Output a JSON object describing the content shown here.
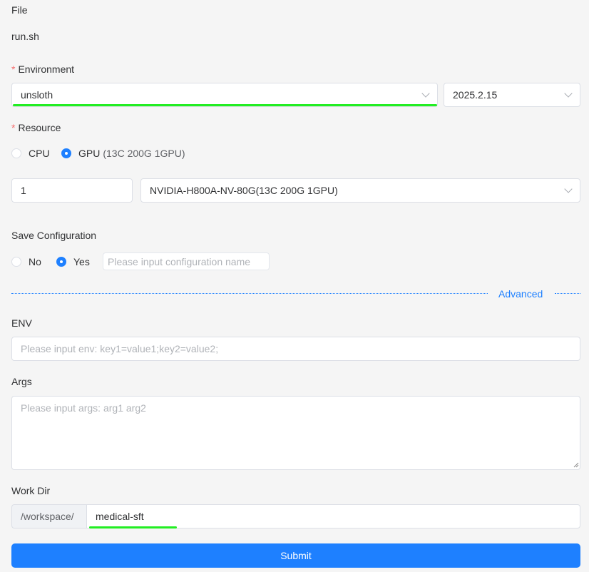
{
  "file": {
    "label": "File",
    "value": "run.sh"
  },
  "environment": {
    "required_mark": "*",
    "label": "Environment",
    "image_value": "unsloth",
    "version_value": "2025.2.15"
  },
  "resource": {
    "required_mark": "*",
    "label": "Resource",
    "options": [
      {
        "label": "CPU",
        "detail": "",
        "checked": false
      },
      {
        "label": "GPU",
        "detail": "(13C 200G 1GPU)",
        "checked": true
      }
    ],
    "count_value": "1",
    "gpu_type_value": "NVIDIA-H800A-NV-80G(13C 200G 1GPU)"
  },
  "save_configuration": {
    "label": "Save Configuration",
    "options": [
      {
        "label": "No",
        "checked": false
      },
      {
        "label": "Yes",
        "checked": true
      }
    ],
    "name_placeholder": "Please input configuration name"
  },
  "advanced": {
    "label": "Advanced"
  },
  "env": {
    "label": "ENV",
    "placeholder": "Please input env: key1=value1;key2=value2;"
  },
  "args": {
    "label": "Args",
    "placeholder": "Please input args: arg1 arg2"
  },
  "work_dir": {
    "label": "Work Dir",
    "prefix": "/workspace/",
    "value": "medical-sft"
  },
  "submit": {
    "label": "Submit"
  },
  "colors": {
    "primary": "#1e80ff",
    "required": "#f56c6c",
    "highlight": "#22ee22"
  }
}
